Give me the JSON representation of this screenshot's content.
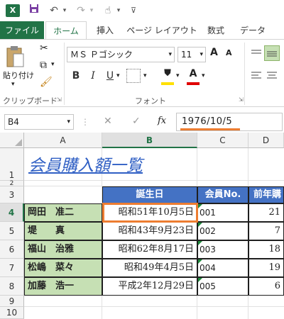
{
  "app_logo": "X",
  "tabs": [
    "ファイル",
    "ホーム",
    "挿入",
    "ページ レイアウト",
    "数式",
    "データ"
  ],
  "ribbon": {
    "paste_label": "貼り付け",
    "clipboard_label": "クリップボード",
    "font_name": "ＭＳ Ｐゴシック",
    "font_size": "11",
    "font_group_label": "フォント",
    "bold": "B",
    "italic": "I",
    "underline": "U",
    "font_grow": "A",
    "font_shrink": "A",
    "font_color_letter": "A",
    "font_color_bar": "#e00000",
    "fill_color_bar": "#ffe000"
  },
  "formula_bar": {
    "name_box": "B4",
    "fx": "fx",
    "value": "1976/10/5"
  },
  "columns": [
    "A",
    "B",
    "C",
    "D"
  ],
  "rows": [
    "1",
    "2",
    "3",
    "4",
    "5",
    "6",
    "7",
    "8",
    "9",
    "10"
  ],
  "sheet": {
    "title": "会員購入額一覧",
    "headers": [
      "誕生日",
      "会員No.",
      "前年購"
    ],
    "records": [
      {
        "name": "岡田　准二",
        "birthday": "昭和51年10月5日",
        "id": "001",
        "amount": "21"
      },
      {
        "name": "堤　　真",
        "birthday": "昭和43年9月23日",
        "id": "002",
        "amount": "7"
      },
      {
        "name": "福山　治雅",
        "birthday": "昭和62年8月17日",
        "id": "003",
        "amount": "18"
      },
      {
        "name": "松嶋　菜々",
        "birthday": "昭和49年4月5日",
        "id": "004",
        "amount": "19"
      },
      {
        "name": "加藤　浩一",
        "birthday": "平成2年12月29日",
        "id": "005",
        "amount": "6"
      }
    ]
  },
  "colors": {
    "excel_green": "#217346",
    "header_blue": "#4472c4",
    "name_green": "#c6e0b4",
    "highlight_orange": "#ed7d31"
  }
}
